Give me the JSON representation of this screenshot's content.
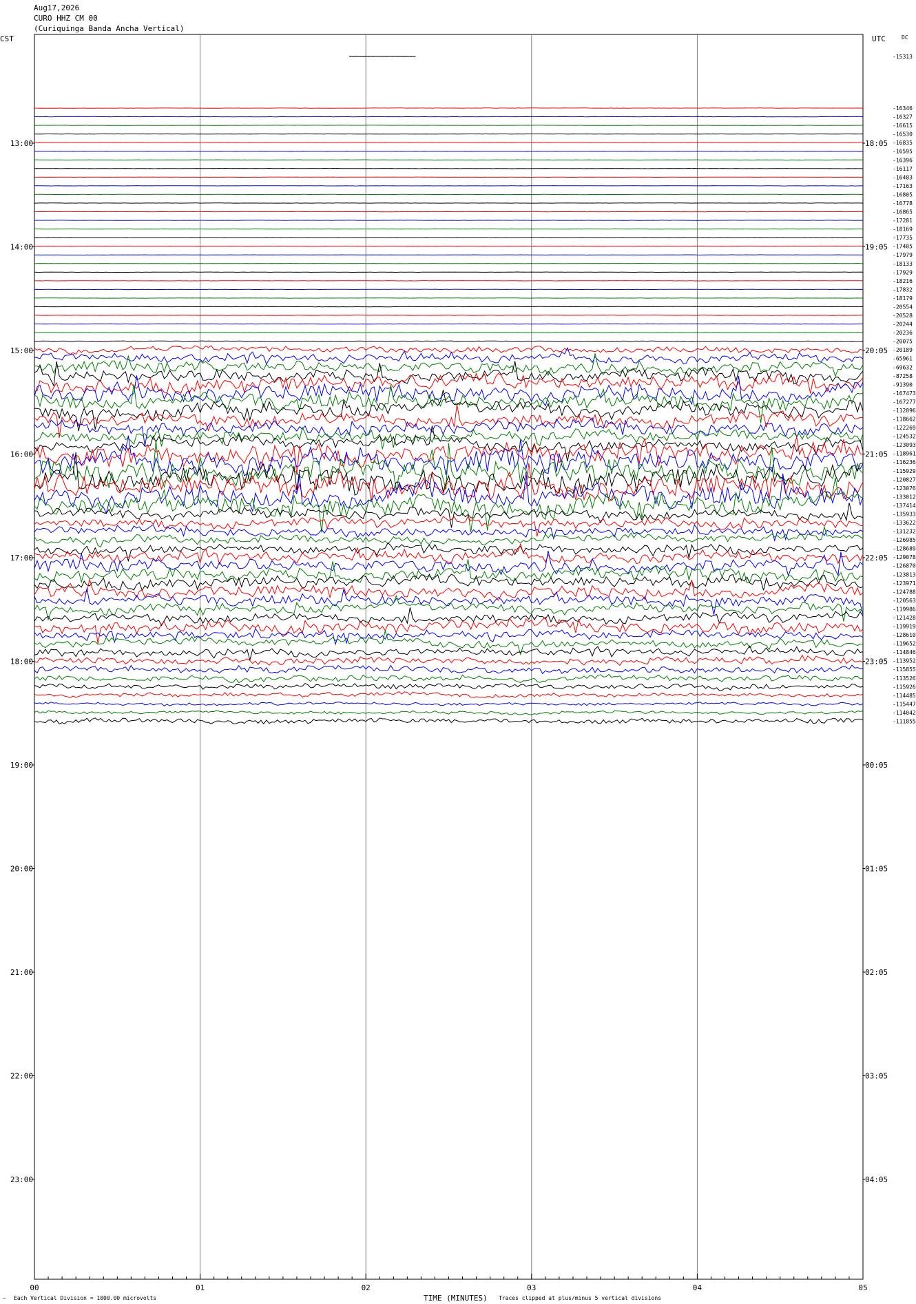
{
  "header": {
    "date": "Aug17,2026",
    "station": "CURO HHZ CM 00",
    "name": "(Curiquinga Banda Ancha Vertical)"
  },
  "labels": {
    "left_zone": "CST",
    "right_zone": "UTC",
    "dc": "DC"
  },
  "footer": {
    "left": "Each Vertical Division = 1000.00 microvolts",
    "center": "TIME (MINUTES)",
    "right": "Traces clipped at plus/minus 5 vertical divisions"
  },
  "colors": {
    "trace_cycle": [
      "#000000",
      "#ff0000",
      "#0000ff",
      "#008000"
    ],
    "grid": "#808080"
  },
  "chart_data": {
    "type": "line",
    "title": "Aug17,2026 CURO HHZ CM 00 (Curiquinga Banda Ancha Vertical)",
    "xlabel": "TIME (MINUTES)",
    "xlim": [
      0,
      5
    ],
    "x_ticks": [
      "00",
      "01",
      "02",
      "03",
      "04",
      "05"
    ],
    "row_minutes": 5,
    "rows_per_hour": 12,
    "y_start_hour": 12,
    "left_hour_labels": [
      "13:00",
      "14:00",
      "15:00",
      "16:00",
      "17:00",
      "18:00",
      "19:00",
      "20:00",
      "21:00",
      "22:00",
      "23:00"
    ],
    "right_hour_labels": [
      "18:05",
      "19:05",
      "20:05",
      "21:05",
      "22:05",
      "23:05",
      "00:05",
      "01:05",
      "02:05",
      "03:05",
      "04:05"
    ],
    "dc_offsets": [
      "-15313",
      "-16346",
      "-16327",
      "-16615",
      "-16530",
      "-16835",
      "-16595",
      "-16396",
      "-16117",
      "-16483",
      "-17163",
      "-16805",
      "-16778",
      "-16865",
      "-17281",
      "-18169",
      "-17735",
      "-17405",
      "-17979",
      "-18133",
      "-17929",
      "-18216",
      "-17832",
      "-18179",
      "-20554",
      "-20528",
      "-20244",
      "-20236",
      "-20075",
      "-20189",
      "-65961",
      "-69632",
      "-87258",
      "-91390",
      "-167473",
      "-167277",
      "-112896",
      "-118662",
      "-122269",
      "-124532",
      "-123093",
      "-118961",
      "-116236",
      "-115929",
      "-120827",
      "-123076",
      "-133012",
      "-137414",
      "-135933",
      "-133622",
      "-131232",
      "-126985",
      "-128689",
      "-129078",
      "-126870",
      "-123813",
      "-123971",
      "-124788",
      "-120563",
      "-119986",
      "-121428",
      "-119919",
      "-128610",
      "-119652",
      "-114846",
      "-113952",
      "-115855",
      "-113526",
      "-115926",
      "-114485",
      "-115447",
      "-114042",
      "-111855"
    ],
    "trace_noise_levels": [
      0.05,
      0.05,
      0.05,
      0.05,
      0.05,
      0.05,
      0.05,
      0.05,
      0.05,
      0.05,
      0.05,
      0.05,
      0.05,
      0.05,
      0.05,
      0.05,
      0.05,
      0.05,
      0.05,
      0.05,
      0.05,
      0.05,
      0.05,
      0.05,
      0.05,
      0.05,
      0.05,
      0.05,
      0.1,
      1.2,
      1.8,
      2.2,
      2.5,
      3.0,
      3.2,
      3.0,
      2.8,
      2.6,
      2.4,
      2.2,
      2.4,
      4.0,
      4.5,
      4.8,
      4.8,
      4.5,
      4.2,
      3.8,
      2.0,
      1.8,
      1.6,
      1.6,
      1.8,
      2.2,
      2.4,
      2.6,
      2.4,
      2.2,
      2.0,
      1.8,
      1.8,
      2.2,
      1.6,
      1.6,
      1.5,
      1.4,
      1.3,
      1.2,
      1.0,
      0.8,
      0.6,
      0.6,
      1.0
    ]
  }
}
